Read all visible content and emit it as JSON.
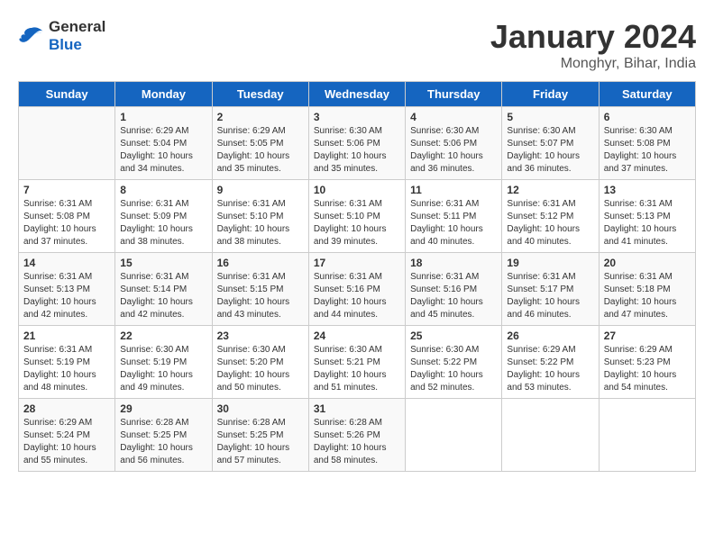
{
  "header": {
    "logo": {
      "general": "General",
      "blue": "Blue"
    },
    "title": "January 2024",
    "location": "Monghyr, Bihar, India"
  },
  "calendar": {
    "days_of_week": [
      "Sunday",
      "Monday",
      "Tuesday",
      "Wednesday",
      "Thursday",
      "Friday",
      "Saturday"
    ],
    "weeks": [
      [
        {
          "day": "",
          "sunrise": "",
          "sunset": "",
          "daylight": ""
        },
        {
          "day": "1",
          "sunrise": "Sunrise: 6:29 AM",
          "sunset": "Sunset: 5:04 PM",
          "daylight": "Daylight: 10 hours and 34 minutes."
        },
        {
          "day": "2",
          "sunrise": "Sunrise: 6:29 AM",
          "sunset": "Sunset: 5:05 PM",
          "daylight": "Daylight: 10 hours and 35 minutes."
        },
        {
          "day": "3",
          "sunrise": "Sunrise: 6:30 AM",
          "sunset": "Sunset: 5:06 PM",
          "daylight": "Daylight: 10 hours and 35 minutes."
        },
        {
          "day": "4",
          "sunrise": "Sunrise: 6:30 AM",
          "sunset": "Sunset: 5:06 PM",
          "daylight": "Daylight: 10 hours and 36 minutes."
        },
        {
          "day": "5",
          "sunrise": "Sunrise: 6:30 AM",
          "sunset": "Sunset: 5:07 PM",
          "daylight": "Daylight: 10 hours and 36 minutes."
        },
        {
          "day": "6",
          "sunrise": "Sunrise: 6:30 AM",
          "sunset": "Sunset: 5:08 PM",
          "daylight": "Daylight: 10 hours and 37 minutes."
        }
      ],
      [
        {
          "day": "7",
          "sunrise": "Sunrise: 6:31 AM",
          "sunset": "Sunset: 5:08 PM",
          "daylight": "Daylight: 10 hours and 37 minutes."
        },
        {
          "day": "8",
          "sunrise": "Sunrise: 6:31 AM",
          "sunset": "Sunset: 5:09 PM",
          "daylight": "Daylight: 10 hours and 38 minutes."
        },
        {
          "day": "9",
          "sunrise": "Sunrise: 6:31 AM",
          "sunset": "Sunset: 5:10 PM",
          "daylight": "Daylight: 10 hours and 38 minutes."
        },
        {
          "day": "10",
          "sunrise": "Sunrise: 6:31 AM",
          "sunset": "Sunset: 5:10 PM",
          "daylight": "Daylight: 10 hours and 39 minutes."
        },
        {
          "day": "11",
          "sunrise": "Sunrise: 6:31 AM",
          "sunset": "Sunset: 5:11 PM",
          "daylight": "Daylight: 10 hours and 40 minutes."
        },
        {
          "day": "12",
          "sunrise": "Sunrise: 6:31 AM",
          "sunset": "Sunset: 5:12 PM",
          "daylight": "Daylight: 10 hours and 40 minutes."
        },
        {
          "day": "13",
          "sunrise": "Sunrise: 6:31 AM",
          "sunset": "Sunset: 5:13 PM",
          "daylight": "Daylight: 10 hours and 41 minutes."
        }
      ],
      [
        {
          "day": "14",
          "sunrise": "Sunrise: 6:31 AM",
          "sunset": "Sunset: 5:13 PM",
          "daylight": "Daylight: 10 hours and 42 minutes."
        },
        {
          "day": "15",
          "sunrise": "Sunrise: 6:31 AM",
          "sunset": "Sunset: 5:14 PM",
          "daylight": "Daylight: 10 hours and 42 minutes."
        },
        {
          "day": "16",
          "sunrise": "Sunrise: 6:31 AM",
          "sunset": "Sunset: 5:15 PM",
          "daylight": "Daylight: 10 hours and 43 minutes."
        },
        {
          "day": "17",
          "sunrise": "Sunrise: 6:31 AM",
          "sunset": "Sunset: 5:16 PM",
          "daylight": "Daylight: 10 hours and 44 minutes."
        },
        {
          "day": "18",
          "sunrise": "Sunrise: 6:31 AM",
          "sunset": "Sunset: 5:16 PM",
          "daylight": "Daylight: 10 hours and 45 minutes."
        },
        {
          "day": "19",
          "sunrise": "Sunrise: 6:31 AM",
          "sunset": "Sunset: 5:17 PM",
          "daylight": "Daylight: 10 hours and 46 minutes."
        },
        {
          "day": "20",
          "sunrise": "Sunrise: 6:31 AM",
          "sunset": "Sunset: 5:18 PM",
          "daylight": "Daylight: 10 hours and 47 minutes."
        }
      ],
      [
        {
          "day": "21",
          "sunrise": "Sunrise: 6:31 AM",
          "sunset": "Sunset: 5:19 PM",
          "daylight": "Daylight: 10 hours and 48 minutes."
        },
        {
          "day": "22",
          "sunrise": "Sunrise: 6:30 AM",
          "sunset": "Sunset: 5:19 PM",
          "daylight": "Daylight: 10 hours and 49 minutes."
        },
        {
          "day": "23",
          "sunrise": "Sunrise: 6:30 AM",
          "sunset": "Sunset: 5:20 PM",
          "daylight": "Daylight: 10 hours and 50 minutes."
        },
        {
          "day": "24",
          "sunrise": "Sunrise: 6:30 AM",
          "sunset": "Sunset: 5:21 PM",
          "daylight": "Daylight: 10 hours and 51 minutes."
        },
        {
          "day": "25",
          "sunrise": "Sunrise: 6:30 AM",
          "sunset": "Sunset: 5:22 PM",
          "daylight": "Daylight: 10 hours and 52 minutes."
        },
        {
          "day": "26",
          "sunrise": "Sunrise: 6:29 AM",
          "sunset": "Sunset: 5:22 PM",
          "daylight": "Daylight: 10 hours and 53 minutes."
        },
        {
          "day": "27",
          "sunrise": "Sunrise: 6:29 AM",
          "sunset": "Sunset: 5:23 PM",
          "daylight": "Daylight: 10 hours and 54 minutes."
        }
      ],
      [
        {
          "day": "28",
          "sunrise": "Sunrise: 6:29 AM",
          "sunset": "Sunset: 5:24 PM",
          "daylight": "Daylight: 10 hours and 55 minutes."
        },
        {
          "day": "29",
          "sunrise": "Sunrise: 6:28 AM",
          "sunset": "Sunset: 5:25 PM",
          "daylight": "Daylight: 10 hours and 56 minutes."
        },
        {
          "day": "30",
          "sunrise": "Sunrise: 6:28 AM",
          "sunset": "Sunset: 5:25 PM",
          "daylight": "Daylight: 10 hours and 57 minutes."
        },
        {
          "day": "31",
          "sunrise": "Sunrise: 6:28 AM",
          "sunset": "Sunset: 5:26 PM",
          "daylight": "Daylight: 10 hours and 58 minutes."
        },
        {
          "day": "",
          "sunrise": "",
          "sunset": "",
          "daylight": ""
        },
        {
          "day": "",
          "sunrise": "",
          "sunset": "",
          "daylight": ""
        },
        {
          "day": "",
          "sunrise": "",
          "sunset": "",
          "daylight": ""
        }
      ]
    ]
  }
}
